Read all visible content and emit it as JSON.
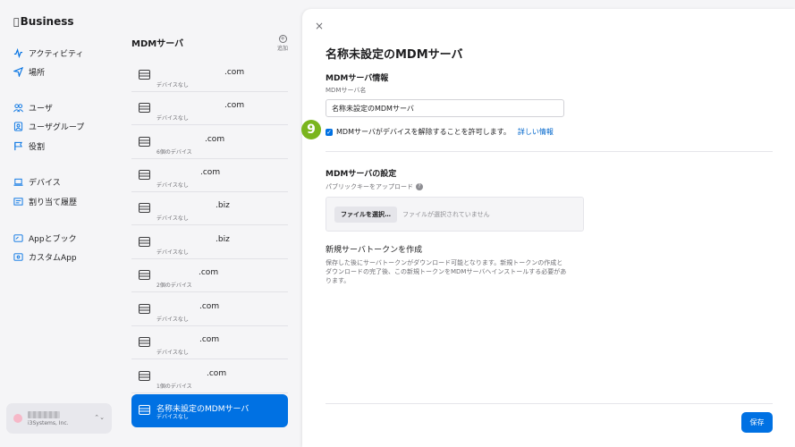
{
  "app": {
    "logo_glyph": "",
    "logo_text": "Business"
  },
  "sidebar": {
    "items": [
      {
        "label": "アクティビティ",
        "icon": "activity-icon"
      },
      {
        "label": "場所",
        "icon": "location-icon"
      },
      {
        "label": "ユーザ",
        "icon": "users-icon"
      },
      {
        "label": "ユーザグループ",
        "icon": "user-group-icon"
      },
      {
        "label": "役割",
        "icon": "flag-icon"
      },
      {
        "label": "デバイス",
        "icon": "laptop-icon"
      },
      {
        "label": "割り当て履歴",
        "icon": "history-icon"
      },
      {
        "label": "Appとブック",
        "icon": "apps-icon"
      },
      {
        "label": "カスタムApp",
        "icon": "custom-app-icon"
      }
    ],
    "account": {
      "org": "i3Systems, Inc."
    }
  },
  "list": {
    "title": "MDMサーバ",
    "add_label": "追加",
    "items": [
      {
        "name": ".com",
        "sub": "デバイスなし"
      },
      {
        "name": ".com",
        "sub": "デバイスなし"
      },
      {
        "name": ".com",
        "sub": "6個のデバイス"
      },
      {
        "name": ".com",
        "sub": "デバイスなし"
      },
      {
        "name": ".biz",
        "sub": "デバイスなし"
      },
      {
        "name": ".biz",
        "sub": "デバイスなし"
      },
      {
        "name": ".com",
        "sub": "2個のデバイス"
      },
      {
        "name": ".com",
        "sub": "デバイスなし"
      },
      {
        "name": ".com",
        "sub": "デバイスなし"
      },
      {
        "name": ".com",
        "sub": "1個のデバイス"
      },
      {
        "name": "名称未設定のMDMサーバ",
        "sub": "デバイスなし"
      }
    ]
  },
  "detail": {
    "close": "×",
    "title": "名称未設定のMDMサーバ",
    "info_title": "MDMサーバ情報",
    "name_label": "MDMサーバ名",
    "name_value": "名称未設定のMDMサーバ",
    "checkbox_label": "MDMサーバがデバイスを解除することを許可します。",
    "more_link": "詳しい情報",
    "step_badge": "9",
    "settings_title": "MDMサーバの設定",
    "upload_label": "パブリックキーをアップロード",
    "help": "?",
    "file_button": "ファイルを選択…",
    "file_none": "ファイルが選択されていません",
    "token_title": "新規サーバトークンを作成",
    "token_desc": "保存した後にサーバトークンがダウンロード可能となります。新規トークンの作成とダウンロードの完了後、この新規トークンをMDMサーバへインストールする必要があります。",
    "save": "保存"
  },
  "colors": {
    "accent": "#0071e3",
    "badge": "#7ab51d",
    "link": "#0066cc"
  }
}
